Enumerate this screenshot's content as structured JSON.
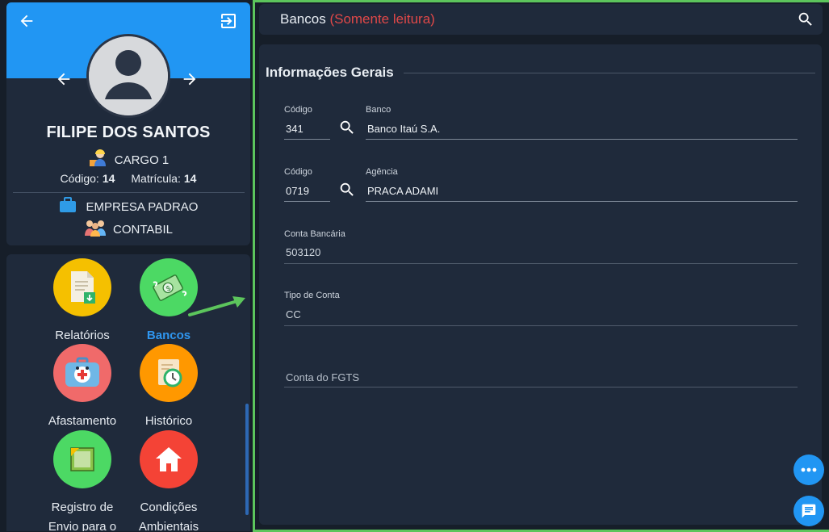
{
  "profile": {
    "name": "FILIPE DOS SANTOS",
    "cargo": "CARGO 1",
    "codigo_label": "Código:",
    "codigo_value": "14",
    "matricula_label": "Matrícula:",
    "matricula_value": "14",
    "empresa": "EMPRESA PADRAO",
    "setor": "CONTABIL"
  },
  "menu": {
    "tiles": [
      {
        "label": "Relatórios",
        "icon": "report-icon",
        "color": "#f5c000"
      },
      {
        "label": "Bancos",
        "icon": "money-icon",
        "color": "#4cd964",
        "active": true
      },
      {
        "label": "Afastamento",
        "icon": "medical-kit-icon",
        "color": "#f06a6a"
      },
      {
        "label": "Histórico",
        "icon": "history-icon",
        "color": "#ff9800"
      },
      {
        "label": "Registro de Envio para o",
        "icon": "note-icon",
        "color": "#4cd964"
      },
      {
        "label": "Condições Ambientais",
        "icon": "home-icon",
        "color": "#f44336"
      }
    ]
  },
  "header": {
    "title": "Bancos",
    "readonly": "(Somente leitura)"
  },
  "section": {
    "title": "Informações Gerais"
  },
  "form": {
    "banco_codigo_label": "Código",
    "banco_codigo_value": "341",
    "banco_label": "Banco",
    "banco_value": "Banco Itaú S.A.",
    "agencia_codigo_label": "Código",
    "agencia_codigo_value": "0719",
    "agencia_label": "Agência",
    "agencia_value": "PRACA ADAMI",
    "conta_label": "Conta Bancária",
    "conta_value": "503120",
    "tipo_label": "Tipo de Conta",
    "tipo_value": "CC",
    "fgts_placeholder": "Conta do FGTS"
  },
  "colors": {
    "accent": "#2196f3",
    "highlight_border": "#5cc55c",
    "readonly": "#e04848"
  }
}
